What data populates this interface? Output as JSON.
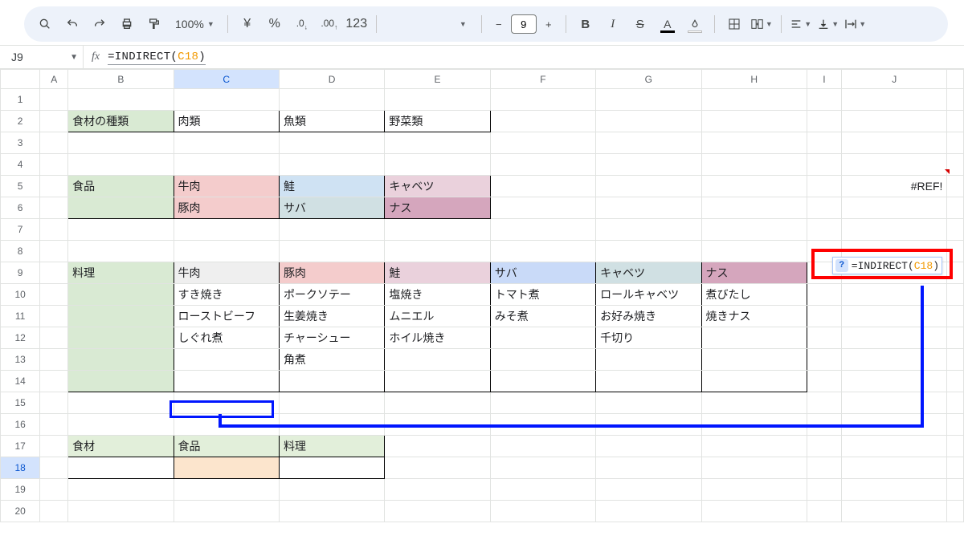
{
  "toolbar": {
    "zoom": "100%",
    "currency": "¥",
    "percent": "%",
    "dec_dec": ".0",
    "dec_inc": ".00",
    "numfmt": "123",
    "font_size": "9"
  },
  "namebox": "J9",
  "formula_plain": "=INDIRECT(C18)",
  "formula_ref": "C18",
  "colHeaders": [
    "A",
    "B",
    "C",
    "D",
    "E",
    "F",
    "G",
    "H",
    "I",
    "J"
  ],
  "rowCount": 20,
  "cells": {
    "B2": "食材の種類",
    "C2": "肉類",
    "D2": "魚類",
    "E2": "野菜類",
    "B5": "食品",
    "C5": "牛肉",
    "D5": "鮭",
    "E5": "キャベツ",
    "C6": "豚肉",
    "D6": "サバ",
    "E6": "ナス",
    "B9": "料理",
    "C9": "牛肉",
    "D9": "豚肉",
    "E9": "鮭",
    "F9": "サバ",
    "G9": "キャベツ",
    "H9": "ナス",
    "C10": "すき焼き",
    "D10": "ポークソテー",
    "E10": "塩焼き",
    "F10": "トマト煮",
    "G10": "ロールキャベツ",
    "H10": "煮びたし",
    "C11": "ローストビーフ",
    "D11": "生姜焼き",
    "E11": "ムニエル",
    "F11": "みそ煮",
    "G11": "お好み焼き",
    "H11": "焼きナス",
    "C12": "しぐれ煮",
    "D12": "チャーシュー",
    "E12": "ホイル焼き",
    "G12": "千切り",
    "D13": "角煮",
    "B17": "食材",
    "C17": "食品",
    "D17": "料理",
    "J5": "#REF!"
  },
  "tooltip": {
    "prefix": "=INDIRECT(",
    "ref": "C18",
    "suffix": ")"
  },
  "chart_data": {
    "type": "table",
    "tables": [
      {
        "title": "食材の種類",
        "headers": [
          "肉類",
          "魚類",
          "野菜類"
        ]
      },
      {
        "title": "食品",
        "columns": [
          "牛肉",
          "鮭",
          "キャベツ"
        ],
        "rows": [
          [
            "豚肉",
            "サバ",
            "ナス"
          ]
        ]
      },
      {
        "title": "料理",
        "columns": [
          "牛肉",
          "豚肉",
          "鮭",
          "サバ",
          "キャベツ",
          "ナス"
        ],
        "rows": [
          [
            "すき焼き",
            "ポークソテー",
            "塩焼き",
            "トマト煮",
            "ロールキャベツ",
            "煮びたし"
          ],
          [
            "ローストビーフ",
            "生姜焼き",
            "ムニエル",
            "みそ煮",
            "お好み焼き",
            "焼きナス"
          ],
          [
            "しぐれ煮",
            "チャーシュー",
            "ホイル焼き",
            "",
            "千切り",
            ""
          ],
          [
            "",
            "角煮",
            "",
            "",
            "",
            ""
          ]
        ]
      }
    ]
  }
}
